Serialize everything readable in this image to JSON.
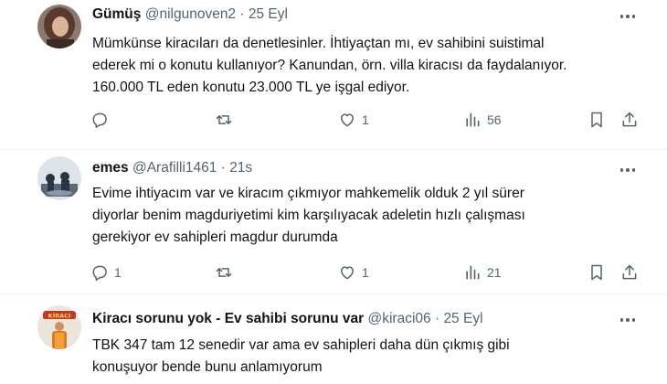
{
  "tweets": [
    {
      "name": "Gümüş",
      "handle": "@nilgunoven2",
      "dot": "·",
      "time": "25 Eyl",
      "lines": [
        "Mümkünse kiracıları da denetlesinler. İhtiyaçtan mı, ev sahibini suistimal",
        "ederek mi o konutu kullanıyor? Kanundan, örn. villa kiracısı da faydalanıyor.",
        "160.000 TL eden konutu  23.000 TL ye işgal ediyor."
      ],
      "reply_count": "",
      "retweet_count": "",
      "like_count": "1",
      "view_count": "56"
    },
    {
      "name": "emes",
      "handle": "@Arafilli1461",
      "dot": "·",
      "time": "21s",
      "lines": [
        "Evime ihtiyacım var ve kiracım çıkmıyor mahkemelik olduk 2 yıl sürer",
        "diyorlar benim magduriyetimi kim karşılıyacak adeletin hızlı çalışması",
        "gerekiyor ev sahipleri magdur durumda"
      ],
      "reply_count": "1",
      "retweet_count": "",
      "like_count": "1",
      "view_count": "21"
    },
    {
      "name": "Kiracı sorunu yok - Ev sahibi sorunu var",
      "handle": "@kiraci06",
      "dot": "·",
      "time": "25 Eyl",
      "lines": [
        "TBK 347 tam 12 senedir var ama ev sahipleri daha dün çıkmış gibi",
        "konuşuyor bende bunu anlamıyorum"
      ]
    }
  ],
  "avatar3_text": "KİRACI",
  "icons": {
    "reply": "reply-icon",
    "retweet": "retweet-icon",
    "like": "heart-icon",
    "views": "views-icon",
    "bookmark": "bookmark-icon",
    "share": "share-icon",
    "more": "more-icon"
  },
  "colors": {
    "text": "#0f1419",
    "secondary": "#536471",
    "divider": "#eff3f4"
  }
}
